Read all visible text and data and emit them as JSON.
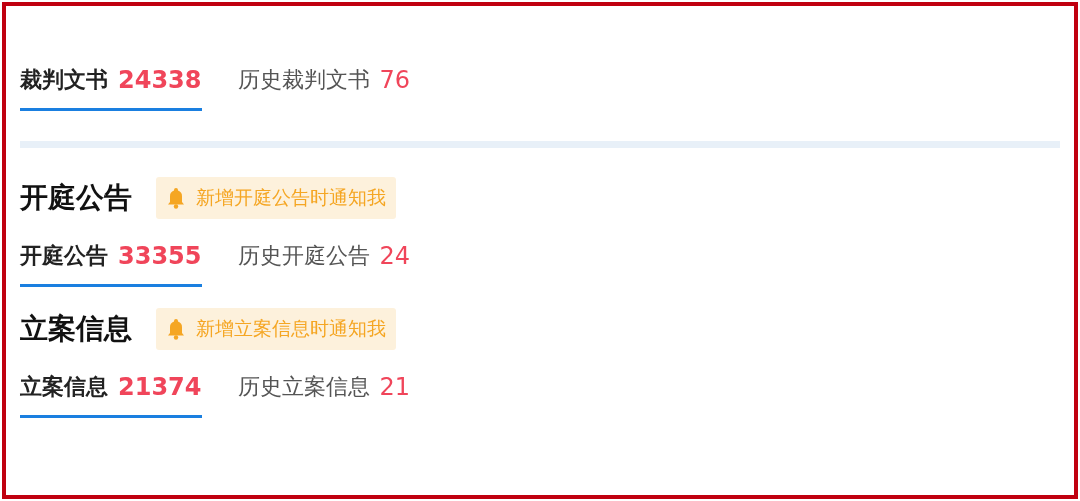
{
  "sections": [
    {
      "tabs": [
        {
          "label": "裁判文书",
          "count": "24338",
          "selected": true
        },
        {
          "label": "历史裁判文书",
          "count": "76",
          "selected": false
        }
      ]
    },
    {
      "title": "开庭公告",
      "notify": "新增开庭公告时通知我",
      "tabs": [
        {
          "label": "开庭公告",
          "count": "33355",
          "selected": true
        },
        {
          "label": "历史开庭公告",
          "count": "24",
          "selected": false
        }
      ]
    },
    {
      "title": "立案信息",
      "notify": "新增立案信息时通知我",
      "tabs": [
        {
          "label": "立案信息",
          "count": "21374",
          "selected": true
        },
        {
          "label": "历史立案信息",
          "count": "21",
          "selected": false
        }
      ]
    }
  ]
}
